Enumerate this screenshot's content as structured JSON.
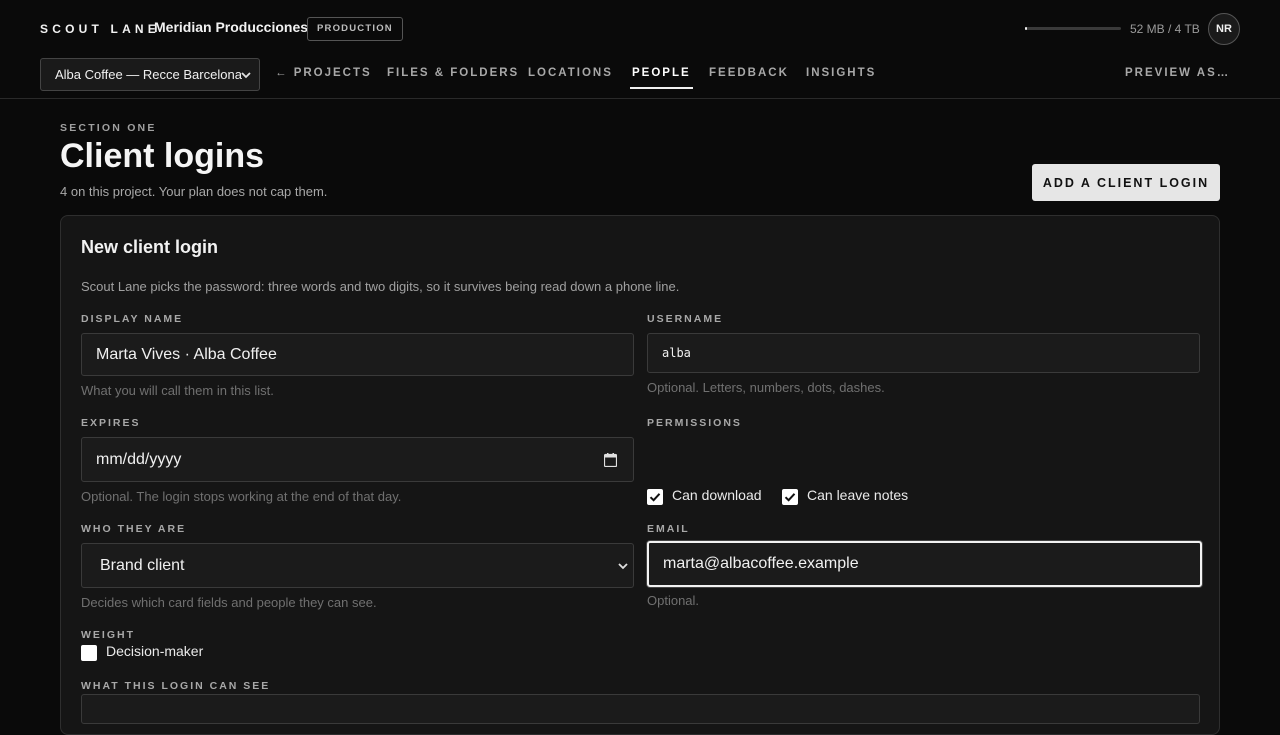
{
  "header": {
    "brand": "SCOUT LANE",
    "org_name": "Meridian Producciones",
    "org_badge": "PRODUCTION",
    "storage_text": "52 MB / 4 TB",
    "storage_fraction": 0.013,
    "avatar_initials": "NR"
  },
  "project_select": {
    "value": "Alba Coffee — Recce Barcelona"
  },
  "nav": {
    "projects": "← PROJECTS",
    "files": "FILES & FOLDERS",
    "locations": "LOCATIONS",
    "people": "PEOPLE",
    "feedback": "FEEDBACK",
    "insights": "INSIGHTS",
    "preview": "PREVIEW AS…",
    "active": "people"
  },
  "page": {
    "eyebrow": "SECTION ONE",
    "title": "Client logins",
    "subtitle": "4 on this project. Your plan does not cap them.",
    "add_button": "ADD A CLIENT LOGIN"
  },
  "form": {
    "title": "New client login",
    "description": "Scout Lane picks the password: three words and two digits, so it survives being read down a phone line.",
    "display_name": {
      "label": "DISPLAY NAME",
      "value": "Marta Vives · Alba Coffee",
      "help": "What you will call them in this list."
    },
    "username": {
      "label": "USERNAME",
      "value": "alba",
      "help": "Optional. Letters, numbers, dots, dashes."
    },
    "expires": {
      "label": "EXPIRES",
      "placeholder": "mm/dd/yyyy",
      "help": "Optional. The login stops working at the end of that day."
    },
    "permissions": {
      "label": "PERMISSIONS",
      "can_download": {
        "label": "Can download",
        "checked": true
      },
      "can_leave_notes": {
        "label": "Can leave notes",
        "checked": true
      }
    },
    "who_they_are": {
      "label": "WHO THEY ARE",
      "value": "Brand client",
      "help": "Decides which card fields and people they can see."
    },
    "email": {
      "label": "EMAIL",
      "value": "marta@albacoffee.example",
      "help": "Optional."
    },
    "weight": {
      "label": "WEIGHT",
      "decision_maker": {
        "label": "Decision-maker",
        "checked": false
      }
    },
    "visibility": {
      "label": "WHAT THIS LOGIN CAN SEE"
    }
  }
}
